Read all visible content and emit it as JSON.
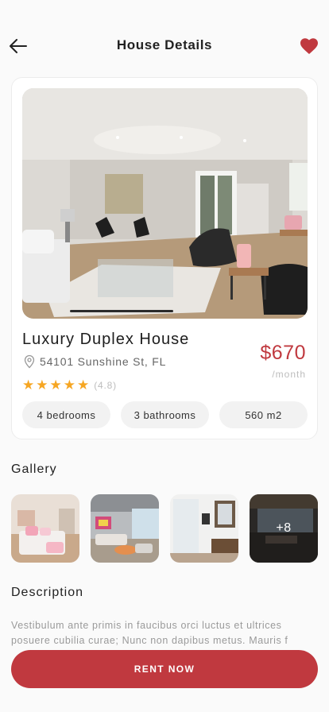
{
  "header": {
    "title": "House Details",
    "back_icon": "arrow-left-icon",
    "favorite_icon": "heart-icon",
    "favorite_color": "#c0393f"
  },
  "property": {
    "name": "Luxury Duplex House",
    "address": "54101 Sunshine St, FL",
    "price": "$670",
    "price_period": "/month",
    "rating_stars": 5,
    "rating_score": "(4.8)",
    "features": [
      "4 bedrooms",
      "3 bathrooms",
      "560 m2"
    ]
  },
  "gallery": {
    "title": "Gallery",
    "more_count": "+8"
  },
  "description": {
    "title": "Description",
    "text": "Vestibulum ante primis in faucibus orci luctus et ultrices posuere cubilia curae; Nunc non dapibus metus. Mauris f"
  },
  "cta": {
    "label": "RENT NOW",
    "color": "#c0393f"
  }
}
